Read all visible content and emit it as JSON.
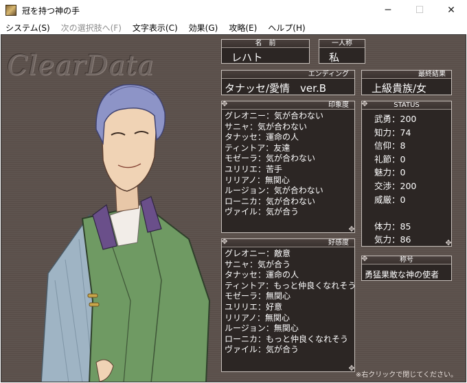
{
  "window": {
    "title": "冠を持つ神の手",
    "minimize_glyph": "─",
    "maximize_glyph": "☐",
    "close_glyph": "✕"
  },
  "menu": {
    "system": "システム(S)",
    "next_choice": "次の選択肢へ(F)",
    "text_display": "文字表示(C)",
    "effects": "効果(G)",
    "strategy": "攻略(E)",
    "help": "ヘルプ(H)"
  },
  "logo": "ClearData",
  "name_panel": {
    "label": "名　前",
    "value": "レハト"
  },
  "pronoun_panel": {
    "label": "一人称",
    "value": "私"
  },
  "ending_panel": {
    "label": "エンディング",
    "value": "タナッセ/愛情　ver.B"
  },
  "final_panel": {
    "label": "最終結果",
    "value": "上級貴族/女"
  },
  "impression_panel": {
    "label": "印象度",
    "rows": [
      "グレオニー：気が合わない",
      "サニャ：気が合わない",
      "タナッセ：運命の人",
      "ティントア：友達",
      "モゼーラ：気が合わない",
      "ユリリエ：苦手",
      "リリアノ：無関心",
      "ルージョン：気が合わない",
      "ローニカ：気が合わない",
      "ヴァイル：気が合う"
    ]
  },
  "favor_panel": {
    "label": "好感度",
    "rows": [
      "グレオニー：敵意",
      "サニャ：気が合う",
      "タナッセ：運命の人",
      "ティントア：もっと仲良くなれそう",
      "モゼーラ：無関心",
      "ユリリエ：好意",
      "リリアノ：無関心",
      "ルージョン：無関心",
      "ローニカ：もっと仲良くなれそう",
      "ヴァイル：気が合う"
    ]
  },
  "status_panel": {
    "label": "STATUS",
    "stats": [
      "武勇：200",
      "知力：74",
      "信仰：8",
      "礼節：0",
      "魅力：0",
      "交渉：200",
      "威厳：0"
    ],
    "vitals": [
      "体力：85",
      "気力：86"
    ]
  },
  "title_panel": {
    "label": "称号",
    "value": "勇猛果敢な神の使者"
  },
  "footer_note": "※右クリックで閉じてください。",
  "colors": {
    "background": "#5a4f4a",
    "panel": "#2c2624",
    "panel_border": "#c9c2bd",
    "coat": "#6f9a63",
    "hair": "#8d94c7"
  }
}
